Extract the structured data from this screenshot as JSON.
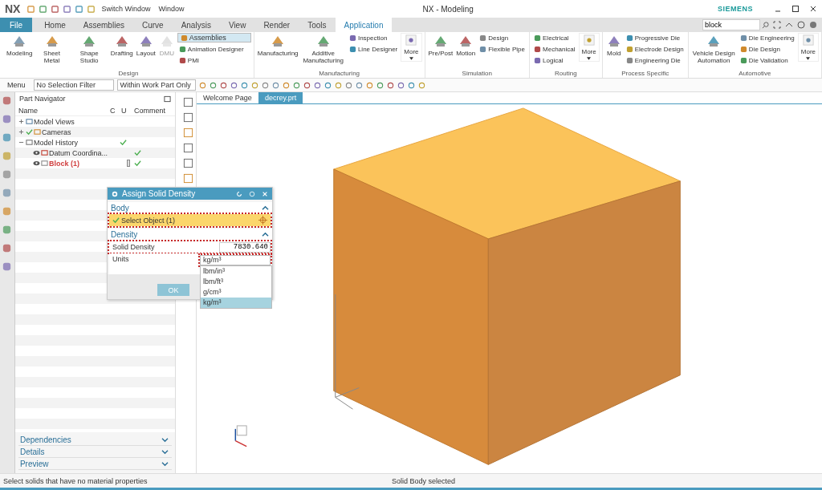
{
  "title_bar": {
    "logo": "NX",
    "quick_access": [
      "Switch Window",
      "Window"
    ],
    "title": "NX - Modeling",
    "brand": "SIEMENS"
  },
  "tabs": [
    {
      "label": "File",
      "kind": "file",
      "selected": false
    },
    {
      "label": "Home",
      "kind": "tab",
      "selected": false
    },
    {
      "label": "Assemblies",
      "kind": "tab",
      "selected": false
    },
    {
      "label": "Curve",
      "kind": "tab",
      "selected": false
    },
    {
      "label": "Analysis",
      "kind": "tab",
      "selected": false
    },
    {
      "label": "View",
      "kind": "tab",
      "selected": false
    },
    {
      "label": "Render",
      "kind": "tab",
      "selected": false
    },
    {
      "label": "Tools",
      "kind": "tab",
      "selected": false
    },
    {
      "label": "Application",
      "kind": "tab",
      "selected": true
    }
  ],
  "search": {
    "value": "block"
  },
  "ribbon": [
    {
      "label": "Design",
      "large": [
        {
          "label": "Modeling",
          "disabled": false
        },
        {
          "label": "Sheet Metal",
          "disabled": false
        },
        {
          "label": "Shape Studio",
          "disabled": false
        },
        {
          "label": "Drafting",
          "disabled": false
        },
        {
          "label": "Layout",
          "disabled": false
        },
        {
          "label": "DMU",
          "disabled": true
        }
      ],
      "small": [
        {
          "label": "Assemblies",
          "selected": true
        },
        {
          "label": "Animation Designer",
          "selected": false
        },
        {
          "label": "PMI",
          "selected": false
        }
      ]
    },
    {
      "label": "Manufacturing",
      "large": [
        {
          "label": "Manufacturing",
          "disabled": false
        },
        {
          "label": "Additive Manufacturing",
          "disabled": false
        }
      ],
      "small": [
        {
          "label": "Inspection",
          "selected": false
        },
        {
          "label": "Line Designer",
          "selected": false
        }
      ],
      "more": "More"
    },
    {
      "label": "Simulation",
      "large": [
        {
          "label": "Pre/Post",
          "disabled": false
        },
        {
          "label": "Motion",
          "disabled": false
        }
      ],
      "small": [
        {
          "label": "Design",
          "selected": false
        },
        {
          "label": "Flexible Pipe",
          "selected": false
        }
      ]
    },
    {
      "label": "Routing",
      "small": [
        {
          "label": "Electrical",
          "selected": false
        },
        {
          "label": "Mechanical",
          "selected": false
        },
        {
          "label": "Logical",
          "selected": false
        }
      ],
      "more": "More"
    },
    {
      "label": "Process Specific",
      "large": [
        {
          "label": "Mold",
          "disabled": false
        }
      ],
      "small": [
        {
          "label": "Progressive Die",
          "selected": false
        },
        {
          "label": "Electrode Design",
          "selected": false
        },
        {
          "label": "Engineering Die",
          "selected": false
        }
      ]
    },
    {
      "label": "Automotive",
      "large": [
        {
          "label": "Vehicle Design Automation",
          "disabled": false
        }
      ],
      "small": [
        {
          "label": "Die Engineering",
          "selected": false
        },
        {
          "label": "Die Design",
          "selected": false
        },
        {
          "label": "Die Validation",
          "selected": false
        }
      ],
      "more": "More"
    }
  ],
  "toolbar": {
    "menu": "Menu",
    "selection_filter": "No Selection Filter",
    "scope": "Within Work Part Only"
  },
  "navigator": {
    "title": "Part Navigator",
    "columns": [
      "Name",
      "C",
      "U",
      "Comment"
    ],
    "rows": [
      {
        "name": "Model Views",
        "kind": "views",
        "expanded": false,
        "checked": false,
        "c_marker": false,
        "u_checked": false,
        "current": false
      },
      {
        "name": "Cameras",
        "kind": "cameras",
        "expanded": false,
        "checked": true,
        "c_marker": false,
        "u_checked": false,
        "current": false
      },
      {
        "name": "Model History",
        "kind": "folder",
        "expanded": true,
        "checked": false,
        "c_marker": false,
        "u_checked": true,
        "current": false,
        "children": [
          {
            "name": "Datum Coordina...",
            "kind": "datum",
            "checked": false,
            "c_marker": false,
            "u_checked": true,
            "current": false
          },
          {
            "name": "Block (1)",
            "kind": "body",
            "checked": false,
            "c_marker": true,
            "u_checked": true,
            "current": true
          }
        ]
      }
    ],
    "panels": [
      {
        "label": "Dependencies",
        "expanded": false
      },
      {
        "label": "Details",
        "expanded": false
      },
      {
        "label": "Preview",
        "expanded": false
      }
    ]
  },
  "graphics_tabs": [
    {
      "label": "Welcome Page",
      "selected": false
    },
    {
      "label": "decrey.prt",
      "selected": true
    }
  ],
  "dialog": {
    "title": "Assign Solid Density",
    "body": {
      "label": "Body",
      "expanded": true,
      "select": {
        "label": "Select Object (1)",
        "done": true,
        "highlight": true
      }
    },
    "density": {
      "label": "Density",
      "expanded": true,
      "field": {
        "label": "Solid Density",
        "value": "7830.640",
        "highlight": true
      },
      "units": {
        "label": "Units",
        "value": "kg/m³",
        "open": true,
        "highlight": true,
        "options": [
          {
            "label": "lbm/in³",
            "selected": false
          },
          {
            "label": "lbm/ft³",
            "selected": false
          },
          {
            "label": "g/cm³",
            "selected": false
          },
          {
            "label": "kg/m³",
            "selected": true
          }
        ]
      }
    },
    "ok": "OK"
  },
  "status_bar": {
    "left": "Select solids that have no material properties",
    "center": "Solid Body selected"
  }
}
